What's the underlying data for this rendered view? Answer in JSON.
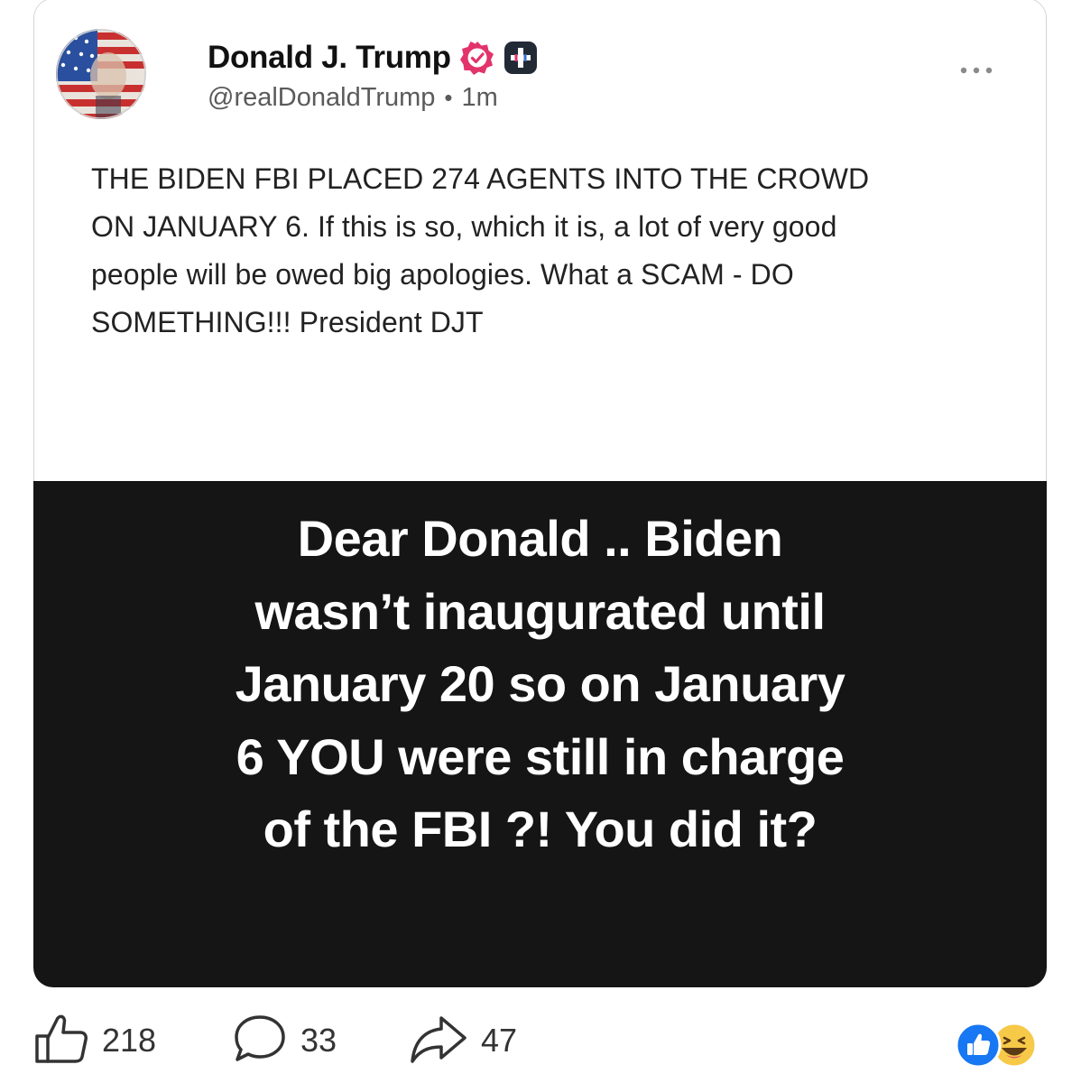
{
  "post": {
    "author_name": "Donald J. Trump",
    "handle": "@realDonaldTrump",
    "separator": "•",
    "time": "1m",
    "body": "THE BIDEN FBI PLACED 274 AGENTS INTO THE CROWD ON JANUARY 6. If this is so, which it is, a lot of very good people will be owed big apologies. What a SCAM - DO SOMETHING!!! President DJT",
    "body_lines": [
      "THE BIDEN FBI PLACED 274 AGENTS INTO THE CROWD",
      "ON JANUARY 6. If this is so, which it is, a lot of very good",
      "people will be owed big apologies. What a SCAM - DO",
      "SOMETHING!!! President DJT"
    ]
  },
  "meme": {
    "lines": [
      "Dear Donald .. Biden",
      "wasn’t inaugurated until",
      "January 20 so on January",
      "6 YOU were still in charge",
      "of the FBI ?! You did it?"
    ]
  },
  "actions": {
    "likes": "218",
    "comments": "33",
    "shares": "47"
  },
  "icons": {
    "verified": "verified-badge-icon",
    "plus": "plus-badge-icon",
    "more": "more-options-icon",
    "like": "thumbs-up-icon",
    "comment": "comment-bubble-icon",
    "share": "share-arrow-icon",
    "reactions": [
      "like-reaction-icon",
      "haha-reaction-icon"
    ]
  },
  "colors": {
    "verified_badge": "#e2336b",
    "meme_background": "#151515",
    "like_reaction": "#1877f2",
    "haha_reaction": "#f7c948"
  }
}
